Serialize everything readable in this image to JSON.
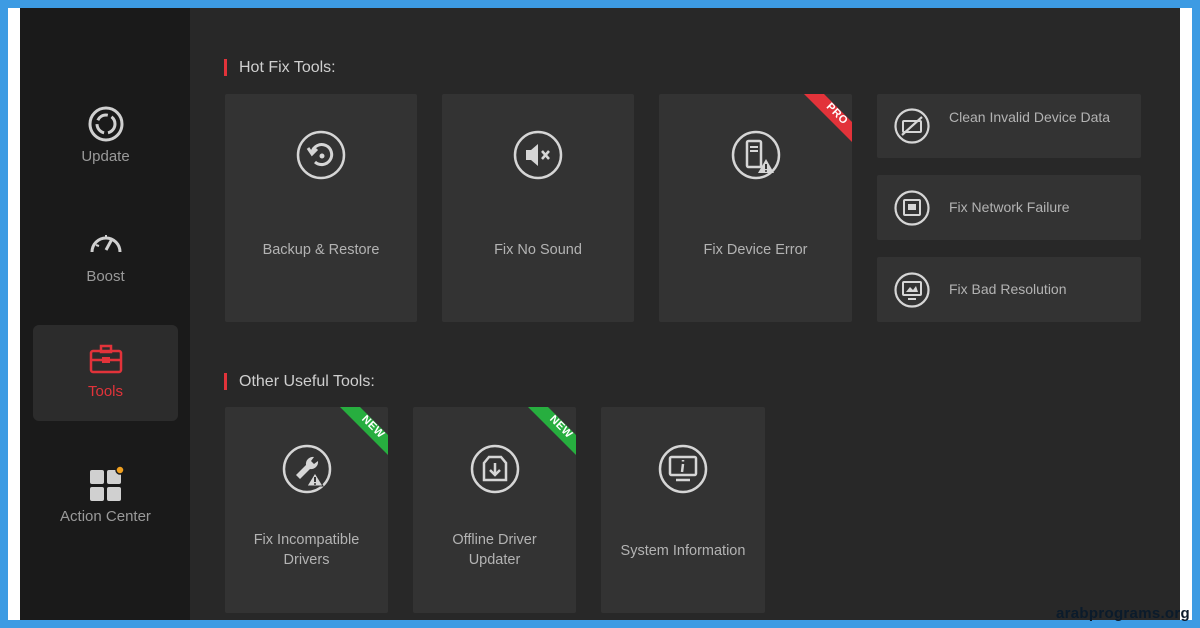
{
  "sidebar": {
    "items": [
      {
        "label": "Update",
        "icon": "update-icon",
        "active": false
      },
      {
        "label": "Boost",
        "icon": "speedometer-icon",
        "active": false
      },
      {
        "label": "Tools",
        "icon": "toolbox-icon",
        "active": true
      },
      {
        "label": "Action Center",
        "icon": "apps-grid-icon",
        "active": false
      }
    ]
  },
  "hot_fix": {
    "title": "Hot Fix Tools:",
    "cards": [
      {
        "label": "Backup & Restore",
        "icon": "restore-icon"
      },
      {
        "label": "Fix No Sound",
        "icon": "mute-speaker-icon"
      },
      {
        "label": "Fix Device Error",
        "icon": "device-warning-icon",
        "badge": "PRO"
      }
    ],
    "side_cards": [
      {
        "label": "Clean Invalid Device Data",
        "icon": "clean-device-icon"
      },
      {
        "label": "Fix Network Failure",
        "icon": "network-port-icon"
      },
      {
        "label": "Fix Bad Resolution",
        "icon": "monitor-resolution-icon"
      }
    ]
  },
  "other": {
    "title": "Other Useful Tools:",
    "cards": [
      {
        "label_line1": "Fix Incompatible",
        "label_line2": "Drivers",
        "icon": "wrench-warning-icon",
        "badge": "NEW"
      },
      {
        "label_line1": "Offline Driver",
        "label_line2": "Updater",
        "icon": "offline-download-icon",
        "badge": "NEW"
      },
      {
        "label": "System Information",
        "icon": "system-info-icon"
      }
    ]
  },
  "colors": {
    "accent_red": "#e2333a",
    "badge_pro": "#e2333a",
    "badge_new": "#27ae3f",
    "frame_blue": "#3d9be3"
  },
  "watermark": "arabprograms.org"
}
